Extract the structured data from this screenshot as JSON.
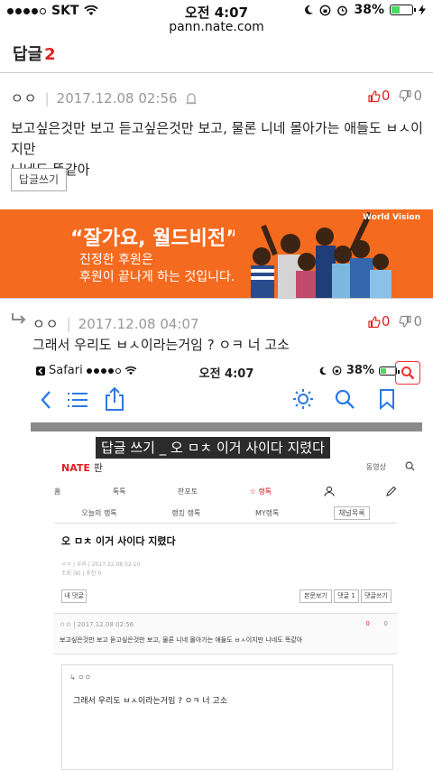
{
  "status_bar": {
    "carrier": "SKT",
    "time": "오전 4:07",
    "battery": "38%",
    "battery_level": 0.38,
    "signal_dots_filled": 4
  },
  "url": "pann.nate.com",
  "replies_header": {
    "label": "답글",
    "count": "2"
  },
  "comments": [
    {
      "author": "ㅇㅇ",
      "date": "2017.12.08 02:56",
      "up": "0",
      "down": "0",
      "text_line1": "보고싶은것만 보고 듣고싶은것만 보고, 물론 니네 몰아가는 애들도 ㅂㅅ이지만",
      "text_line2": "니네도 똑같아",
      "write_reply_label": "답글쓰기"
    },
    {
      "author": "ㅇㅇ",
      "date": "2017.12.08 04:07",
      "up": "0",
      "down": "0",
      "text": "그래서 우리도 ㅂㅅ이라는거임 ? ㅇㅋ 너 고소"
    }
  ],
  "banner": {
    "title": "“잘가요, 월드비전”",
    "line1": "진정한 후원은",
    "line2": "후원이 끝나게 하는 것입니다.",
    "brand": "World Vision",
    "color": "#f46a1e"
  },
  "embedded_screenshot": {
    "app_back": "Safari",
    "time": "오전 4:07",
    "battery": "38%",
    "dark_title": "답글 쓰기 _ 오 ㅁㅊ 이거 사이다 지렸다",
    "site_logo": "NATE",
    "site_section": "판",
    "video_label": "동영상",
    "nav": [
      "홈",
      "톡톡",
      "판포토",
      "☆ 랭톡"
    ],
    "subnav": [
      "오늘의 랭톡",
      "랭킹 랭톡",
      "MY랭톡"
    ],
    "channel_btn": "채널목록",
    "article_title": "오 ㅁㅊ 이거 사이다 지렸다",
    "article_meta1": "ㅇㅇ  |  우리  |  2017.12.08 02:10",
    "article_meta2": "조회 (8)  |  추천 0",
    "my_reply_btn": "내 댓글",
    "btn_view": "본문보기",
    "btn_reply": "댓글 1",
    "btn_write": "댓글쓰기",
    "inner_author_date": "ㅇㅇ | 2017.12.08 02:56",
    "inner_votes_up": "0",
    "inner_votes_down": "0",
    "inner_text": "보고싶은것만 보고 듣고싶은것만 보고, 물론 니네 몰아가는 애들도 ㅂㅅ이지만 니네도 똑같아",
    "inner_reply_author": "ㅇㅇ",
    "inner_reply_text": "그래서 우리도 ㅂㅅ이라는거임 ? ㅇㅋ 너 고소"
  }
}
